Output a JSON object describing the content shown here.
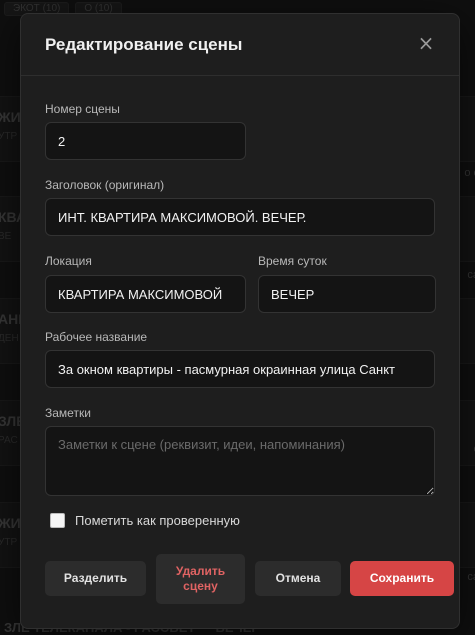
{
  "background": {
    "chips": [
      "ЭКОТ (10)",
      "О (10)"
    ],
    "cards": [
      {
        "title": "ЖИ",
        "sub": "УТР",
        "right": ""
      },
      {
        "title": "КВАРТ",
        "sub": "ВЕ",
        "right": "о с"
      },
      {
        "title": "АНИ",
        "sub": "ДЕН",
        "right": "са"
      },
      {
        "title": "ЗЛЕ",
        "sub": "РАС",
        "right": "с"
      },
      {
        "title": "ЖИ",
        "sub": "УТР",
        "right": "са"
      }
    ],
    "bottom_text": "ЗЛЕ ТЕЛЕКАНАЛА - РАССВЕТ — ВЕЧЕР"
  },
  "modal": {
    "title": "Редактирование сцены",
    "close_icon": "close-icon",
    "scene_number": {
      "label": "Номер сцены",
      "value": "2"
    },
    "heading": {
      "label": "Заголовок (оригинал)",
      "value": "ИНТ. КВАРТИРА МАКСИМОВОЙ. ВЕЧЕР."
    },
    "location": {
      "label": "Локация",
      "value": "КВАРТИРА МАКСИМОВОЙ"
    },
    "time_of_day": {
      "label": "Время суток",
      "value": "ВЕЧЕР"
    },
    "working_title": {
      "label": "Рабочее название",
      "value": "За окном квартиры - пасмурная окраинная улица Санкт"
    },
    "notes": {
      "label": "Заметки",
      "value": "",
      "placeholder": "Заметки к сцене (реквизит, идеи, напоминания)"
    },
    "checked_checkbox": {
      "label": "Пометить как проверенную",
      "checked": false
    },
    "buttons": {
      "split": "Разделить",
      "delete": "Удалить сцену",
      "cancel": "Отмена",
      "save": "Сохранить"
    },
    "colors": {
      "accent": "#d64545",
      "delete_text": "#e06363"
    }
  }
}
